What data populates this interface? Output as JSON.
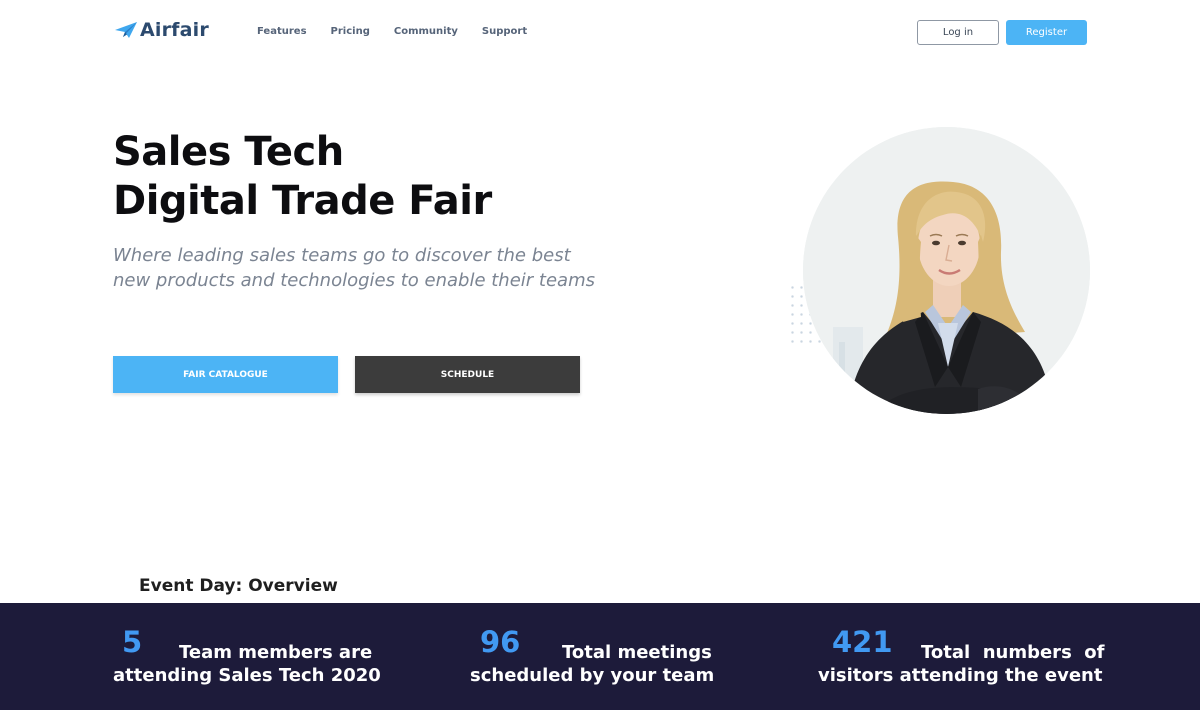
{
  "nav": {
    "logo_text": "Airfair",
    "links": [
      "Features",
      "Pricing",
      "Community",
      "Support"
    ],
    "login_label": "Log in",
    "register_label": "Register"
  },
  "hero": {
    "title_line1": "Sales Tech",
    "title_line2": "Digital Trade Fair",
    "subtitle_line1": "Where leading sales teams go to discover the best",
    "subtitle_line2": "new products and technologies to enable their teams",
    "catalogue_label": "FAIR CATALOGUE",
    "schedule_label": "SCHEDULE"
  },
  "overview": {
    "title": "Event Day: Overview",
    "stats": [
      {
        "number": "5",
        "line1": "Team members are",
        "line2": "attending Sales Tech 2020"
      },
      {
        "number": "96",
        "line1": "Total meetings",
        "line2": "scheduled by your team"
      },
      {
        "number": "421",
        "line1": "Total  numbers  of",
        "line2": "visitors attending the event"
      }
    ]
  },
  "colors": {
    "accent": "#4cb4f5",
    "dark_button": "#3c3c3c",
    "stats_band": "#1d1b3a",
    "stat_number": "#4199f2"
  }
}
